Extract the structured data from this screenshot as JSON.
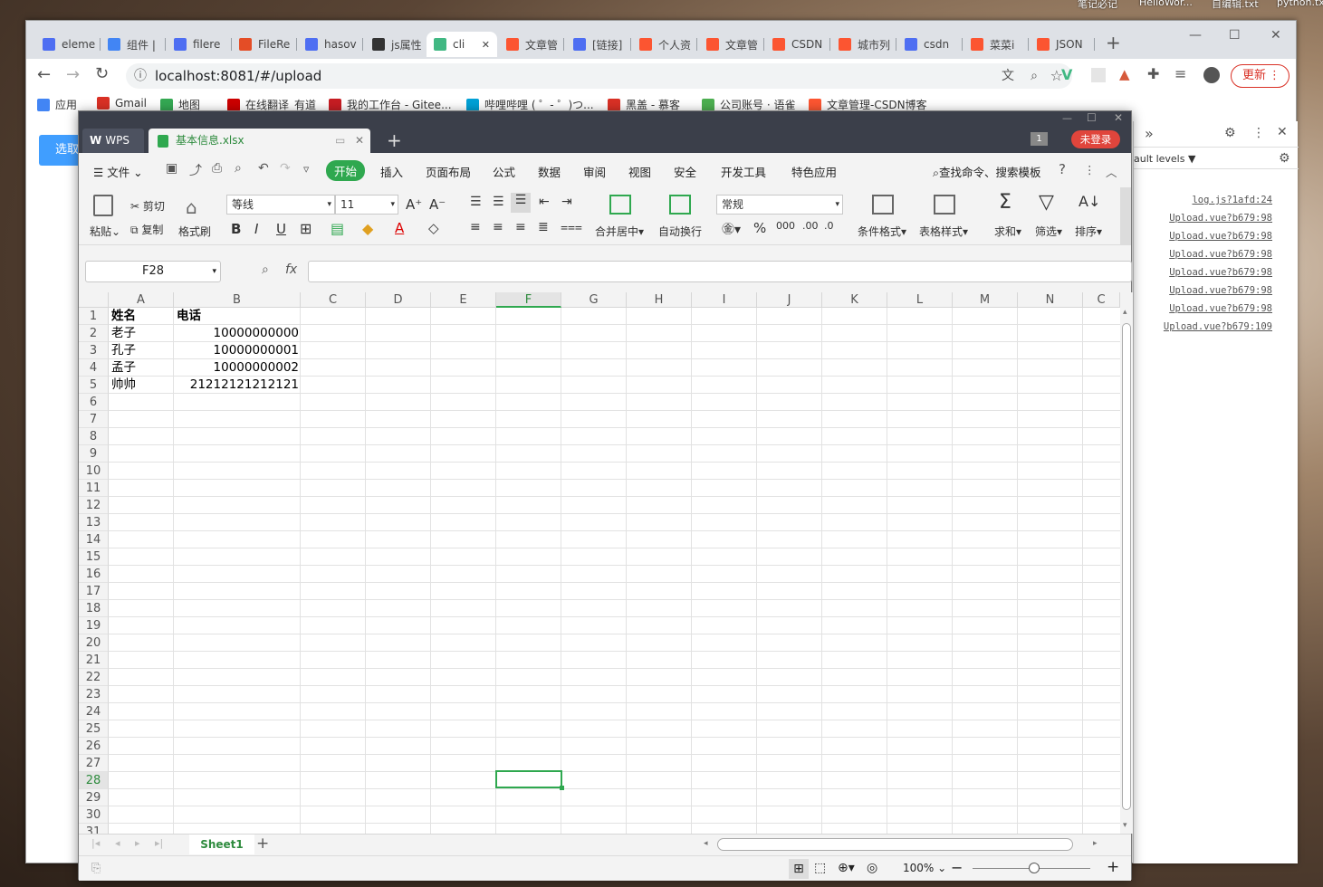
{
  "desktop": {
    "labels": [
      "笔记必记",
      "HelloWor...",
      "自编辑.txt",
      "python.tx"
    ]
  },
  "browser": {
    "tabs": [
      "eleme",
      "组件 |",
      "filere",
      "FileRe",
      "hasov",
      "js属性",
      "cli",
      "文章管",
      "[链接]",
      "个人资",
      "文章管",
      "CSDN",
      "城市列",
      "csdn",
      "菜菜i",
      "JSON"
    ],
    "active_tab_index": 6,
    "url": "localhost:8081/#/upload",
    "update_label": "更新",
    "bookmarks": [
      "应用",
      "Gmail",
      "地图",
      "在线翻译_有道",
      "我的工作台 - Gitee...",
      "哔哩哔哩 ( ゜- ゜)つ...",
      "黑盖 - 慕客",
      "公司账号 · 语雀",
      "文章管理-CSDN博客"
    ]
  },
  "page": {
    "button_label": "选取"
  },
  "devtools": {
    "levels_label": "ault levels ▼",
    "logs": [
      "log.js?1afd:24",
      "Upload.vue?b679:98",
      "Upload.vue?b679:98",
      "Upload.vue?b679:98",
      "Upload.vue?b679:98",
      "Upload.vue?b679:98",
      "Upload.vue?b679:98",
      "Upload.vue?b679:109"
    ]
  },
  "wps": {
    "home_label": "WPS",
    "doc_tab": "基本信息.xlsx",
    "login_label": "未登录",
    "page_count": "1",
    "file_menu": "文件",
    "menus": [
      "开始",
      "插入",
      "页面布局",
      "公式",
      "数据",
      "审阅",
      "视图",
      "安全",
      "开发工具",
      "特色应用"
    ],
    "active_menu": "开始",
    "search_label": "查找命令、搜索模板",
    "ribbon": {
      "paste": "粘贴",
      "cut": "剪切",
      "copy": "复制",
      "format_painter": "格式刷",
      "font": "等线",
      "font_size": "11",
      "merge": "合并居中",
      "wrap": "自动换行",
      "number_format": "常规",
      "cond_format": "条件格式",
      "table_style": "表格样式",
      "sum": "求和",
      "filter": "筛选",
      "sort": "排序"
    },
    "name_box": "F28",
    "fx": "fx",
    "columns": [
      "A",
      "B",
      "C",
      "D",
      "E",
      "F",
      "G",
      "H",
      "I",
      "J",
      "K",
      "L",
      "M",
      "N",
      "C"
    ],
    "selected_column": "F",
    "rows": [
      "1",
      "2",
      "3",
      "4",
      "5",
      "6",
      "7",
      "8",
      "9",
      "10",
      "11",
      "12",
      "13",
      "14",
      "15",
      "16",
      "17",
      "18",
      "19",
      "20",
      "21",
      "22",
      "23",
      "24",
      "25",
      "26",
      "27",
      "28",
      "29",
      "30",
      "31"
    ],
    "selected_row": "28",
    "cells": {
      "header": {
        "name": "姓名",
        "phone": "电话"
      },
      "data": [
        {
          "name": "老子",
          "phone": "10000000000"
        },
        {
          "name": "孔子",
          "phone": "10000000001"
        },
        {
          "name": "孟子",
          "phone": "10000000002"
        },
        {
          "name": "帅帅",
          "phone": "21212121212121"
        }
      ]
    },
    "sheet_tab": "Sheet1",
    "zoom": "100%"
  }
}
